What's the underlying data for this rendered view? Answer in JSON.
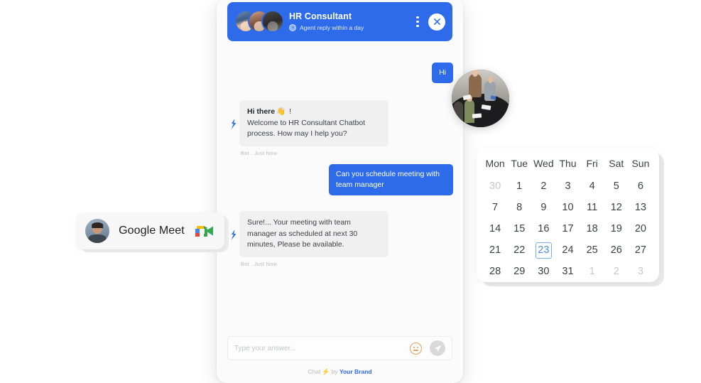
{
  "chat": {
    "header": {
      "title": "HR Consultant",
      "subtitle": "Agent reply within a day",
      "clock_icon": "clock-icon",
      "menu_icon": "more-vertical-icon",
      "close_icon": "close-icon"
    },
    "messages": [
      {
        "id": "m1",
        "side": "right",
        "sender": "user",
        "text": "Hi",
        "stamp": ""
      },
      {
        "id": "m2",
        "side": "left",
        "sender": "bot",
        "bold_lead": "Hi there",
        "emoji": "👋",
        "lead_tail": " !",
        "text": "Welcome to HR Consultant Chatbot process. How may I help you?",
        "stamp": "Bot . Just Now"
      },
      {
        "id": "m3",
        "side": "right",
        "sender": "user",
        "text": "Can you schedule meeting with team manager",
        "stamp": ""
      },
      {
        "id": "m4",
        "side": "left",
        "sender": "bot",
        "text": "Sure!... Your meeting with team manager as scheduled at next 30 minutes, Please be available.",
        "stamp": "Bot . Just Now"
      }
    ],
    "composer": {
      "placeholder": "Type your answer...",
      "value": "",
      "emoji_icon": "smiley-icon",
      "send_icon": "send-plane-icon"
    },
    "footer": {
      "chat_label": "Chat",
      "bolt": "⚡",
      "by_label": "by",
      "brand": "Your Brand"
    }
  },
  "calendar": {
    "day_headers": [
      "Mon",
      "Tue",
      "Wed",
      "Thu",
      "Fri",
      "Sat",
      "Sun"
    ],
    "weeks": [
      [
        {
          "d": "30",
          "muted": true
        },
        {
          "d": "1"
        },
        {
          "d": "2"
        },
        {
          "d": "3"
        },
        {
          "d": "4"
        },
        {
          "d": "5"
        },
        {
          "d": "6"
        }
      ],
      [
        {
          "d": "7"
        },
        {
          "d": "8"
        },
        {
          "d": "9"
        },
        {
          "d": "10"
        },
        {
          "d": "11"
        },
        {
          "d": "12"
        },
        {
          "d": "13"
        }
      ],
      [
        {
          "d": "14"
        },
        {
          "d": "15"
        },
        {
          "d": "16"
        },
        {
          "d": "17"
        },
        {
          "d": "18"
        },
        {
          "d": "19"
        },
        {
          "d": "20"
        }
      ],
      [
        {
          "d": "21"
        },
        {
          "d": "22"
        },
        {
          "d": "23",
          "selected": true
        },
        {
          "d": "24"
        },
        {
          "d": "25"
        },
        {
          "d": "26"
        },
        {
          "d": "27"
        }
      ],
      [
        {
          "d": "28"
        },
        {
          "d": "29"
        },
        {
          "d": "30"
        },
        {
          "d": "31"
        },
        {
          "d": "1",
          "muted": true
        },
        {
          "d": "2",
          "muted": true
        },
        {
          "d": "3",
          "muted": true
        }
      ]
    ],
    "selected_day": "23"
  },
  "meet_card": {
    "label": "Google Meet",
    "avatar_icon": "person-avatar",
    "logo_icon": "google-meet-logo"
  },
  "meeting_photo": {
    "icon": "meeting-photo"
  },
  "colors": {
    "brand_blue": "#2d6beb",
    "bot_bubble": "#f0f0f1",
    "panel_bg": "#fbfbfb",
    "selected_day_border": "#7ab0e8",
    "selected_day_text": "#4a8fd8",
    "bolt_yellow": "#f5b733",
    "emoji_outline": "#e0a05e",
    "send_bg": "#d9d9d9"
  }
}
